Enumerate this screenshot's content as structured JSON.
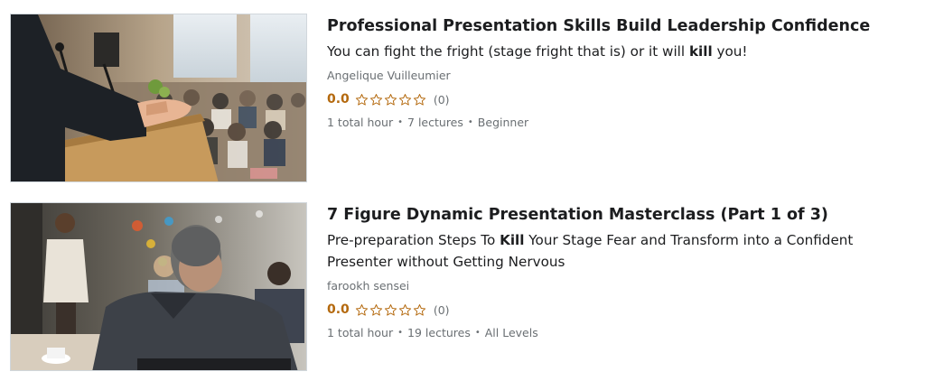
{
  "courses": [
    {
      "title": "Professional Presentation Skills Build Leadership Confidence",
      "headline_before": "You can fight the fright (stage fright that is) or it will ",
      "headline_keyword": "kill",
      "headline_after": " you!",
      "author": "Angelique Vuilleumier",
      "rating": "0.0",
      "rating_fraction": 0,
      "rating_count": "(0)",
      "duration": "1 total hour",
      "lectures": "7 lectures",
      "level": "Beginner",
      "thumbnail": "speaker-at-podium-image"
    },
    {
      "title": "7 Figure Dynamic Presentation Masterclass (Part 1 of 3)",
      "headline_before": "Pre-preparation Steps To ",
      "headline_keyword": "Kill",
      "headline_after": " Your Stage Fear and Transform into a Confident Presenter without Getting Nervous",
      "author": "farookh sensei",
      "rating": "0.0",
      "rating_fraction": 0,
      "rating_count": "(0)",
      "duration": "1 total hour",
      "lectures": "19 lectures",
      "level": "All Levels",
      "thumbnail": "audience-watching-presenter-image"
    }
  ],
  "separator": "•",
  "colors": {
    "rating": "#b4690e",
    "star": "#b4690e",
    "muted_text": "#6a6f73",
    "title_text": "#1c1d1f"
  },
  "icons": {
    "star": "star-outline-icon"
  }
}
